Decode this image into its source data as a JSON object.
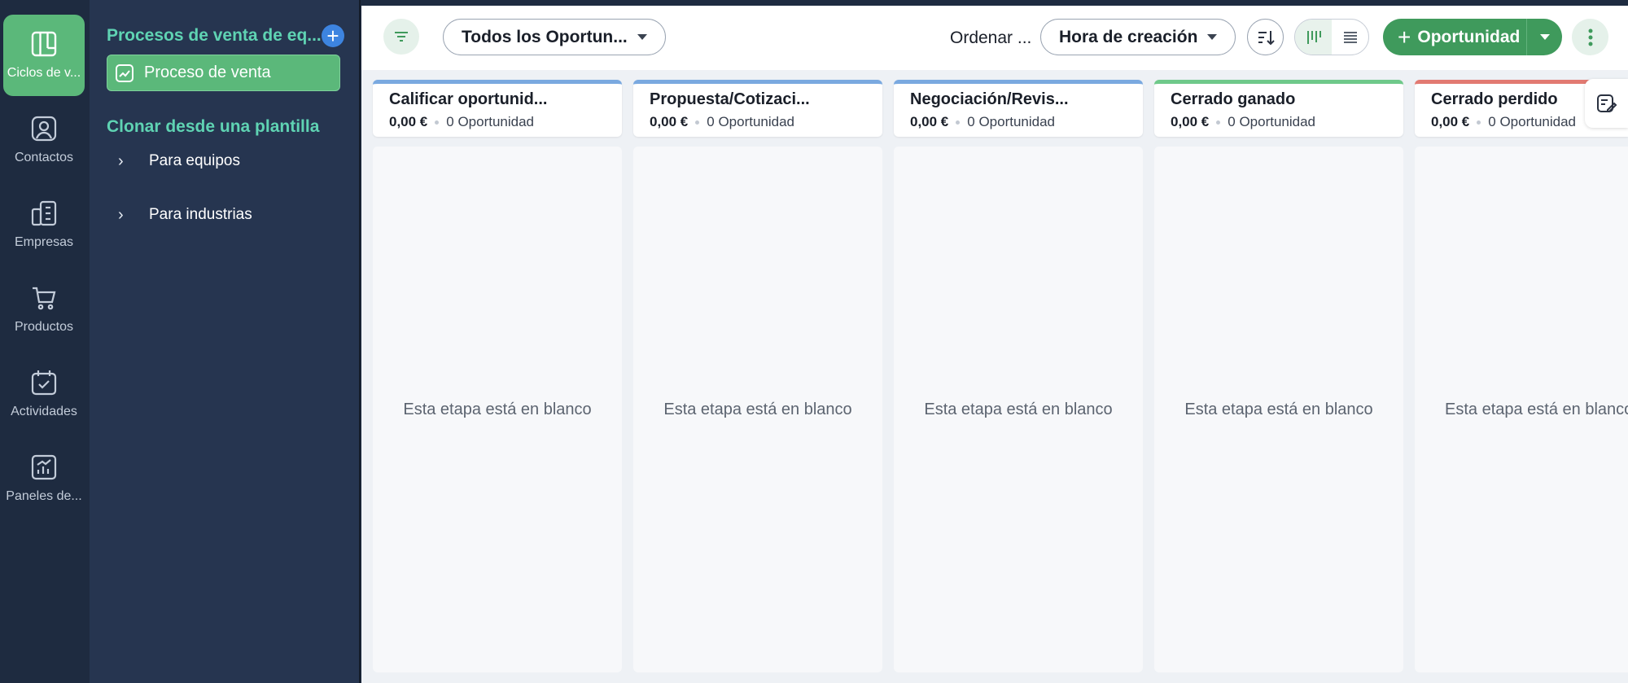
{
  "rail": {
    "items": [
      {
        "label": "Ciclos de v...",
        "icon": "pipeline-icon"
      },
      {
        "label": "Contactos",
        "icon": "contact-icon"
      },
      {
        "label": "Empresas",
        "icon": "building-icon"
      },
      {
        "label": "Productos",
        "icon": "cart-icon"
      },
      {
        "label": "Actividades",
        "icon": "calendar-check-icon"
      },
      {
        "label": "Paneles de...",
        "icon": "dashboard-icon"
      }
    ]
  },
  "sidebar": {
    "title": "Procesos de venta de eq...",
    "add_label": "+",
    "process_item": "Proceso de venta",
    "clone_title": "Clonar desde una plantilla",
    "tree": [
      "Para equipos",
      "Para industrias"
    ]
  },
  "toolbar": {
    "view_select": "Todos los Oportun...",
    "sort_label": "Ordenar ...",
    "sort_select": "Hora de creación",
    "primary_label": "Oportunidad",
    "primary_plus": "+"
  },
  "stages": [
    {
      "name": "Calificar oportunid...",
      "amount": "0,00 €",
      "count": "0 Oportunidad",
      "color": "#7aa9e0",
      "empty": "Esta etapa está en blanco"
    },
    {
      "name": "Propuesta/Cotizaci...",
      "amount": "0,00 €",
      "count": "0 Oportunidad",
      "color": "#7aa9e0",
      "empty": "Esta etapa está en blanco"
    },
    {
      "name": "Negociación/Revis...",
      "amount": "0,00 €",
      "count": "0 Oportunidad",
      "color": "#7aa9e0",
      "empty": "Esta etapa está en blanco"
    },
    {
      "name": "Cerrado ganado",
      "amount": "0,00 €",
      "count": "0 Oportunidad",
      "color": "#6fc98a",
      "empty": "Esta etapa está en blanco"
    },
    {
      "name": "Cerrado perdido",
      "amount": "0,00 €",
      "count": "0 Oportunidad",
      "color": "#e27a72",
      "empty": "Esta etapa está en blanco"
    }
  ],
  "colors": {
    "accent": "#5bb87a",
    "primary": "#3f9a5c",
    "sidebar_heading": "#5fd3b3"
  }
}
